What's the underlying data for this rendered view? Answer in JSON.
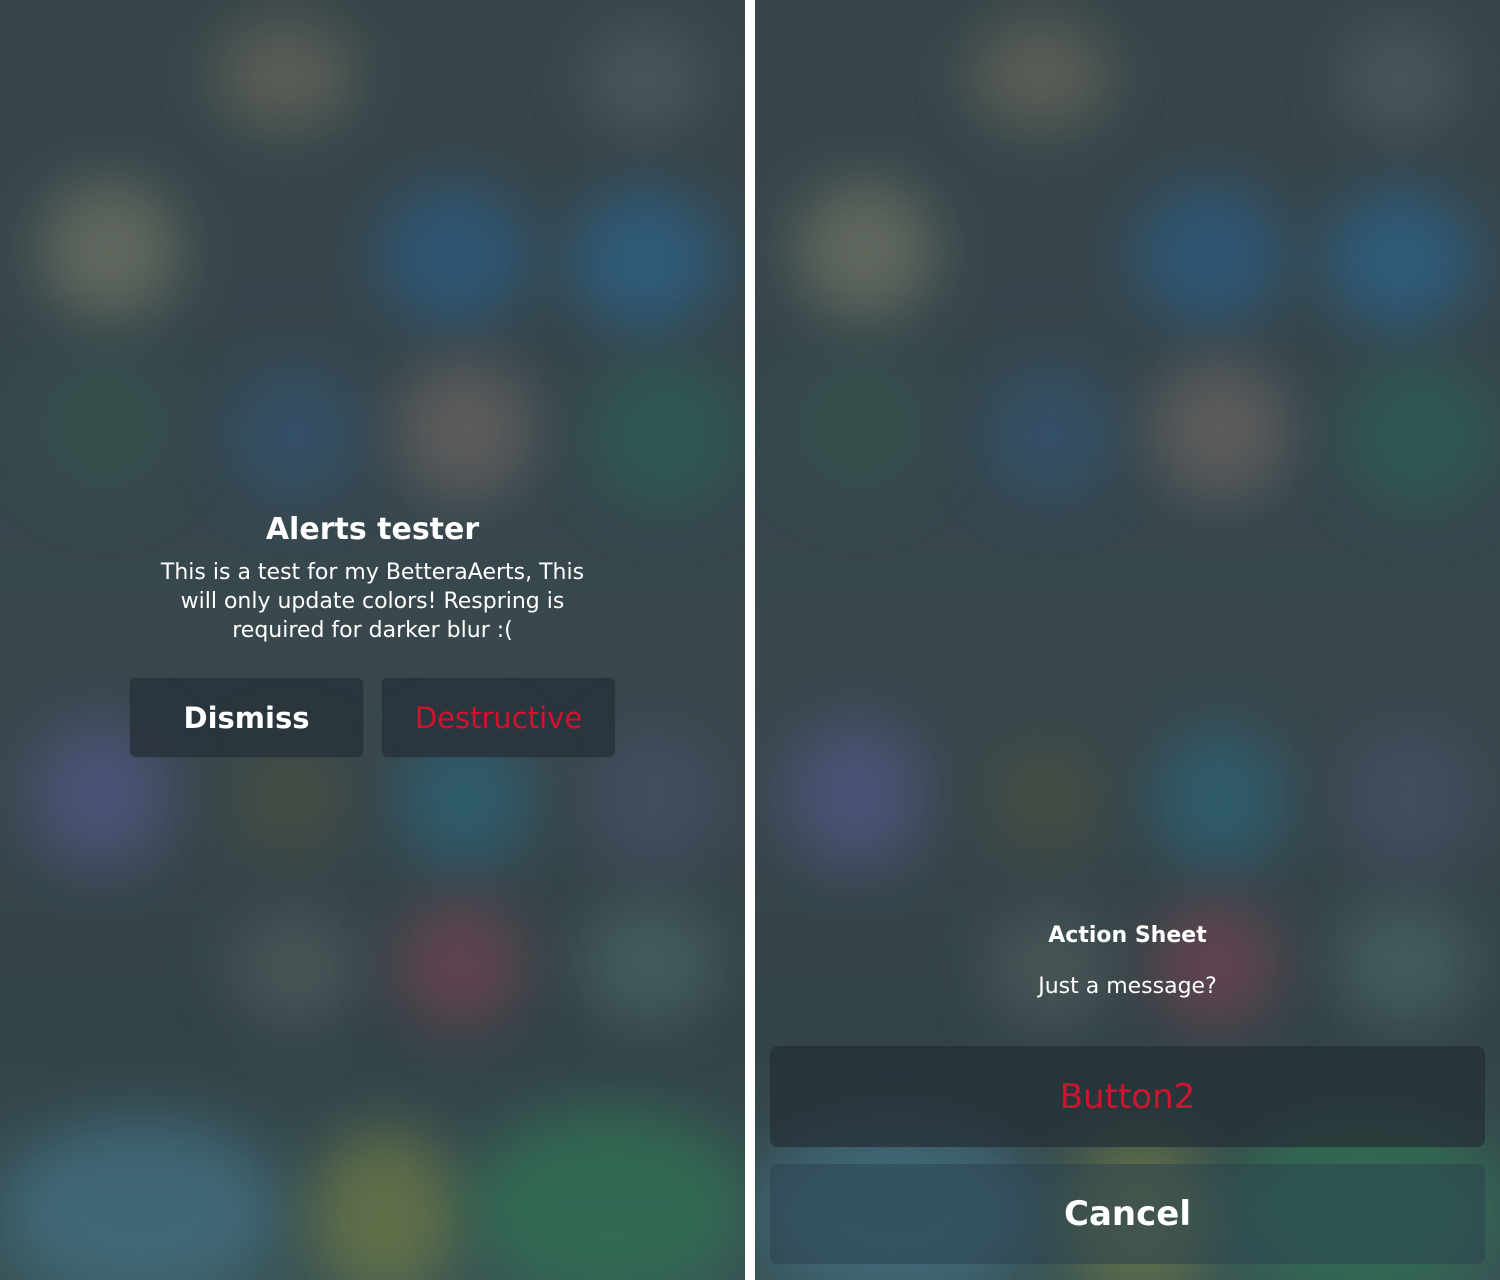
{
  "alert": {
    "title": "Alerts tester",
    "message": "This is a test for my BetteraAerts, This will only update colors! Respring is required for darker blur :(",
    "buttons": {
      "dismiss": "Dismiss",
      "destructive": "Destructive"
    }
  },
  "action_sheet": {
    "title": "Action Sheet",
    "message": "Just a message?",
    "buttons": {
      "button2": "Button2",
      "cancel": "Cancel"
    }
  },
  "colors": {
    "destructive": "#d0142e",
    "text": "#ffffff",
    "divider": "#ffffff"
  }
}
